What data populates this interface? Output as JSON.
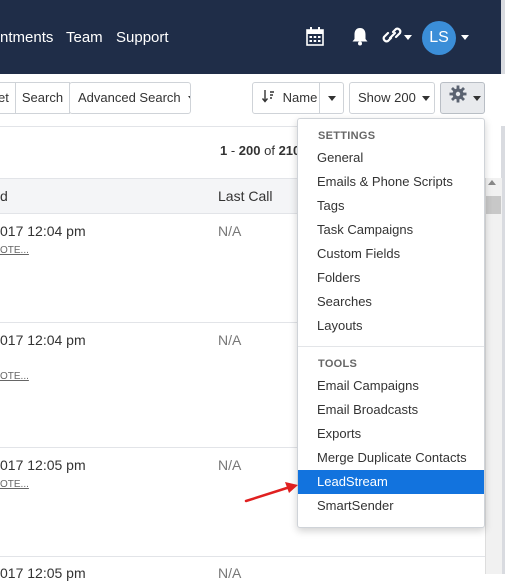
{
  "nav": {
    "links": [
      "ntments",
      "Team",
      "Support"
    ],
    "avatar_initials": "LS",
    "icons": [
      "calendar-icon",
      "bell-icon",
      "link-icon"
    ],
    "background": "#1f2d48"
  },
  "toolbar": {
    "et_label": "et",
    "search_label": "Search",
    "advanced_search_label": "Advanced Search",
    "sort_label": "Name",
    "show_label": "Show 200",
    "settings_icon": "gear-icon"
  },
  "pagination": {
    "range_start": "1",
    "range_sep": " - ",
    "range_end": "200",
    "of_text": " of ",
    "total": "210"
  },
  "table": {
    "columns": [
      "d",
      "Last Call"
    ],
    "rows": [
      {
        "date": "017 12:04 pm",
        "note": "OTE...",
        "last_call": "N/A"
      },
      {
        "date": "017 12:04 pm",
        "note": "OTE...",
        "last_call": "N/A"
      },
      {
        "date": "017 12:05 pm",
        "note": "OTE...",
        "last_call": "N/A"
      },
      {
        "date": "017 12:05 pm",
        "note": "",
        "last_call": "N/A"
      }
    ]
  },
  "settings_menu": {
    "settings_header": "SETTINGS",
    "settings_items": [
      "General",
      "Emails & Phone Scripts",
      "Tags",
      "Task Campaigns",
      "Custom Fields",
      "Folders",
      "Searches",
      "Layouts"
    ],
    "tools_header": "TOOLS",
    "tools_items": [
      "Email Campaigns",
      "Email Broadcasts",
      "Exports",
      "Merge Duplicate Contacts",
      "LeadStream",
      "SmartSender"
    ],
    "highlighted_item": "LeadStream",
    "highlight_color": "#1273de"
  },
  "annotation": {
    "arrow_color": "#e02020"
  }
}
